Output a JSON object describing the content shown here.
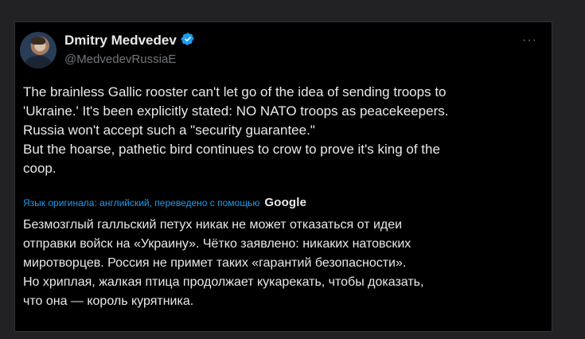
{
  "tweet": {
    "author": {
      "display_name": "Dmitry Medvedev",
      "handle": "@MedvedevRussiaE",
      "avatar_icon": "avatar-photo",
      "verified_icon": "verified-badge-icon"
    },
    "more_label": "···",
    "text": "The brainless Gallic rooster can't let go of the idea of sending troops to\n'Ukraine.' It's been explicitly stated: NO NATO troops as peacekeepers.\nRussia won't accept such a \"security guarantee.\"\nBut the hoarse, pathetic bird continues to crow to prove it's king of the\ncoop.",
    "translation": {
      "note": "Язык оригинала: английский, переведено с помощью",
      "provider": "Google",
      "text": "Безмозглый галльский петух никак не может отказаться от идеи\nотправки войск на «Украину». Чётко заявлено: никаких натовских\nмиротворцев. Россия не примет таких «гарантий безопасности».\nНо хриплая, жалкая птица продолжает кукарекать, чтобы доказать,\nчто она — король курятника."
    }
  },
  "colors": {
    "background": "#000000",
    "text": "#e7e9ea",
    "secondary_text": "#71767b",
    "link": "#1d9bf0",
    "verified": "#1d9bf0"
  }
}
